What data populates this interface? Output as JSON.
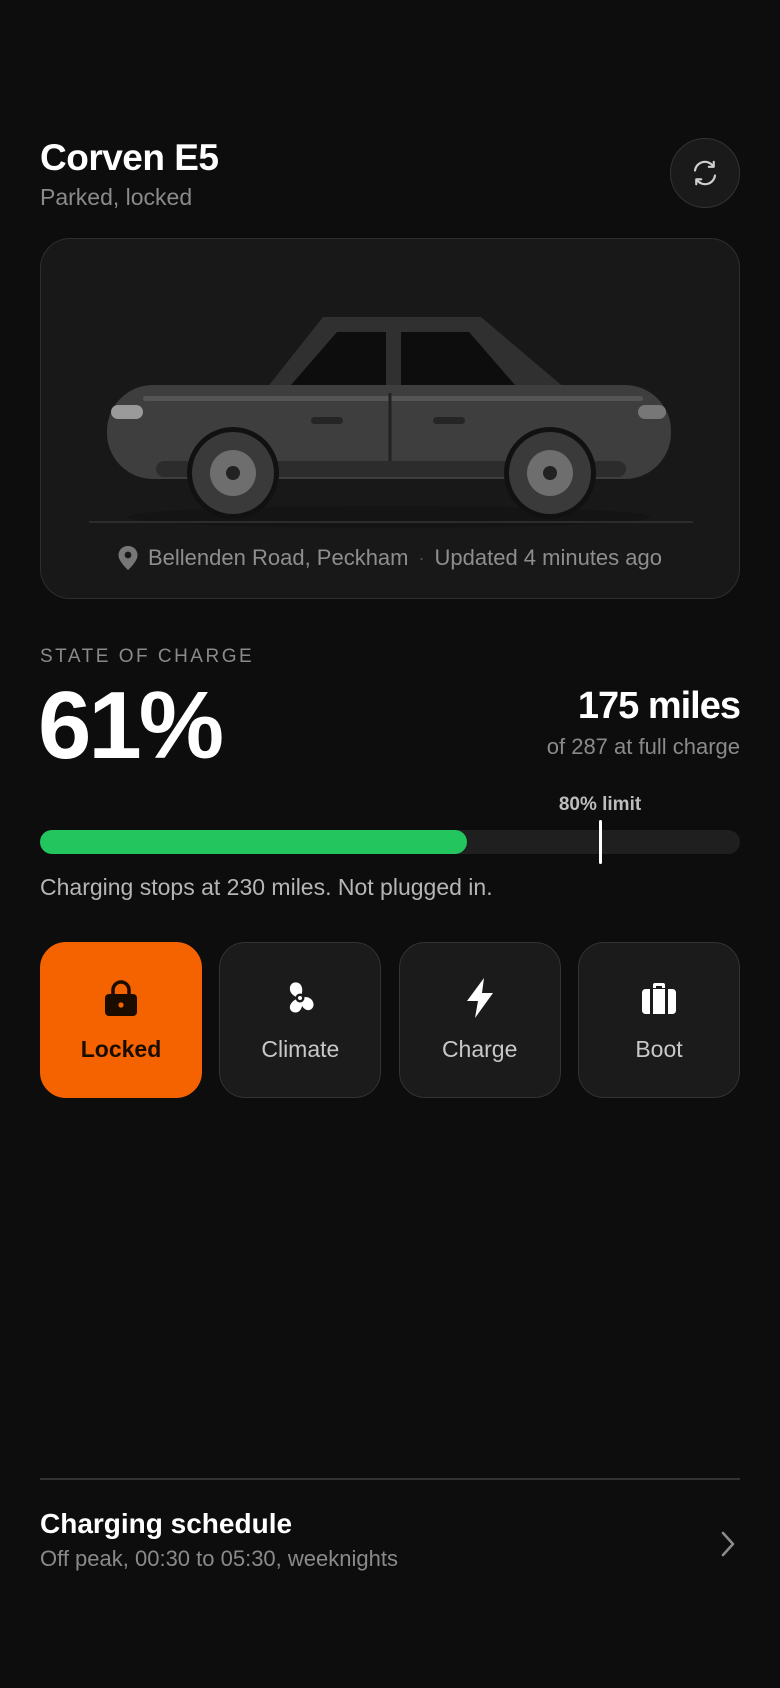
{
  "vehicle": {
    "name": "Corven E5",
    "status": "Parked, locked"
  },
  "location": {
    "address": "Bellenden Road, Peckham",
    "separator": "·",
    "updated": "Updated 4 minutes ago"
  },
  "charge": {
    "label": "STATE OF CHARGE",
    "percent_text": "61%",
    "percent": 61,
    "range_text": "175 miles",
    "range_sub": "of 287 at full charge",
    "limit_text": "80% limit",
    "limit_percent": 80,
    "note": "Charging stops at 230 miles. Not plugged in.",
    "bar_color": "#22c55e"
  },
  "actions": [
    {
      "label": "Locked",
      "icon": "lock-icon",
      "active": true
    },
    {
      "label": "Climate",
      "icon": "fan-icon",
      "active": false
    },
    {
      "label": "Charge",
      "icon": "bolt-icon",
      "active": false
    },
    {
      "label": "Boot",
      "icon": "boot-icon",
      "active": false
    }
  ],
  "schedule": {
    "title": "Charging schedule",
    "subtitle": "Off peak, 00:30 to 05:30, weeknights"
  },
  "colors": {
    "accent": "#f56301",
    "background": "#0d0d0d",
    "charge": "#22c55e"
  }
}
